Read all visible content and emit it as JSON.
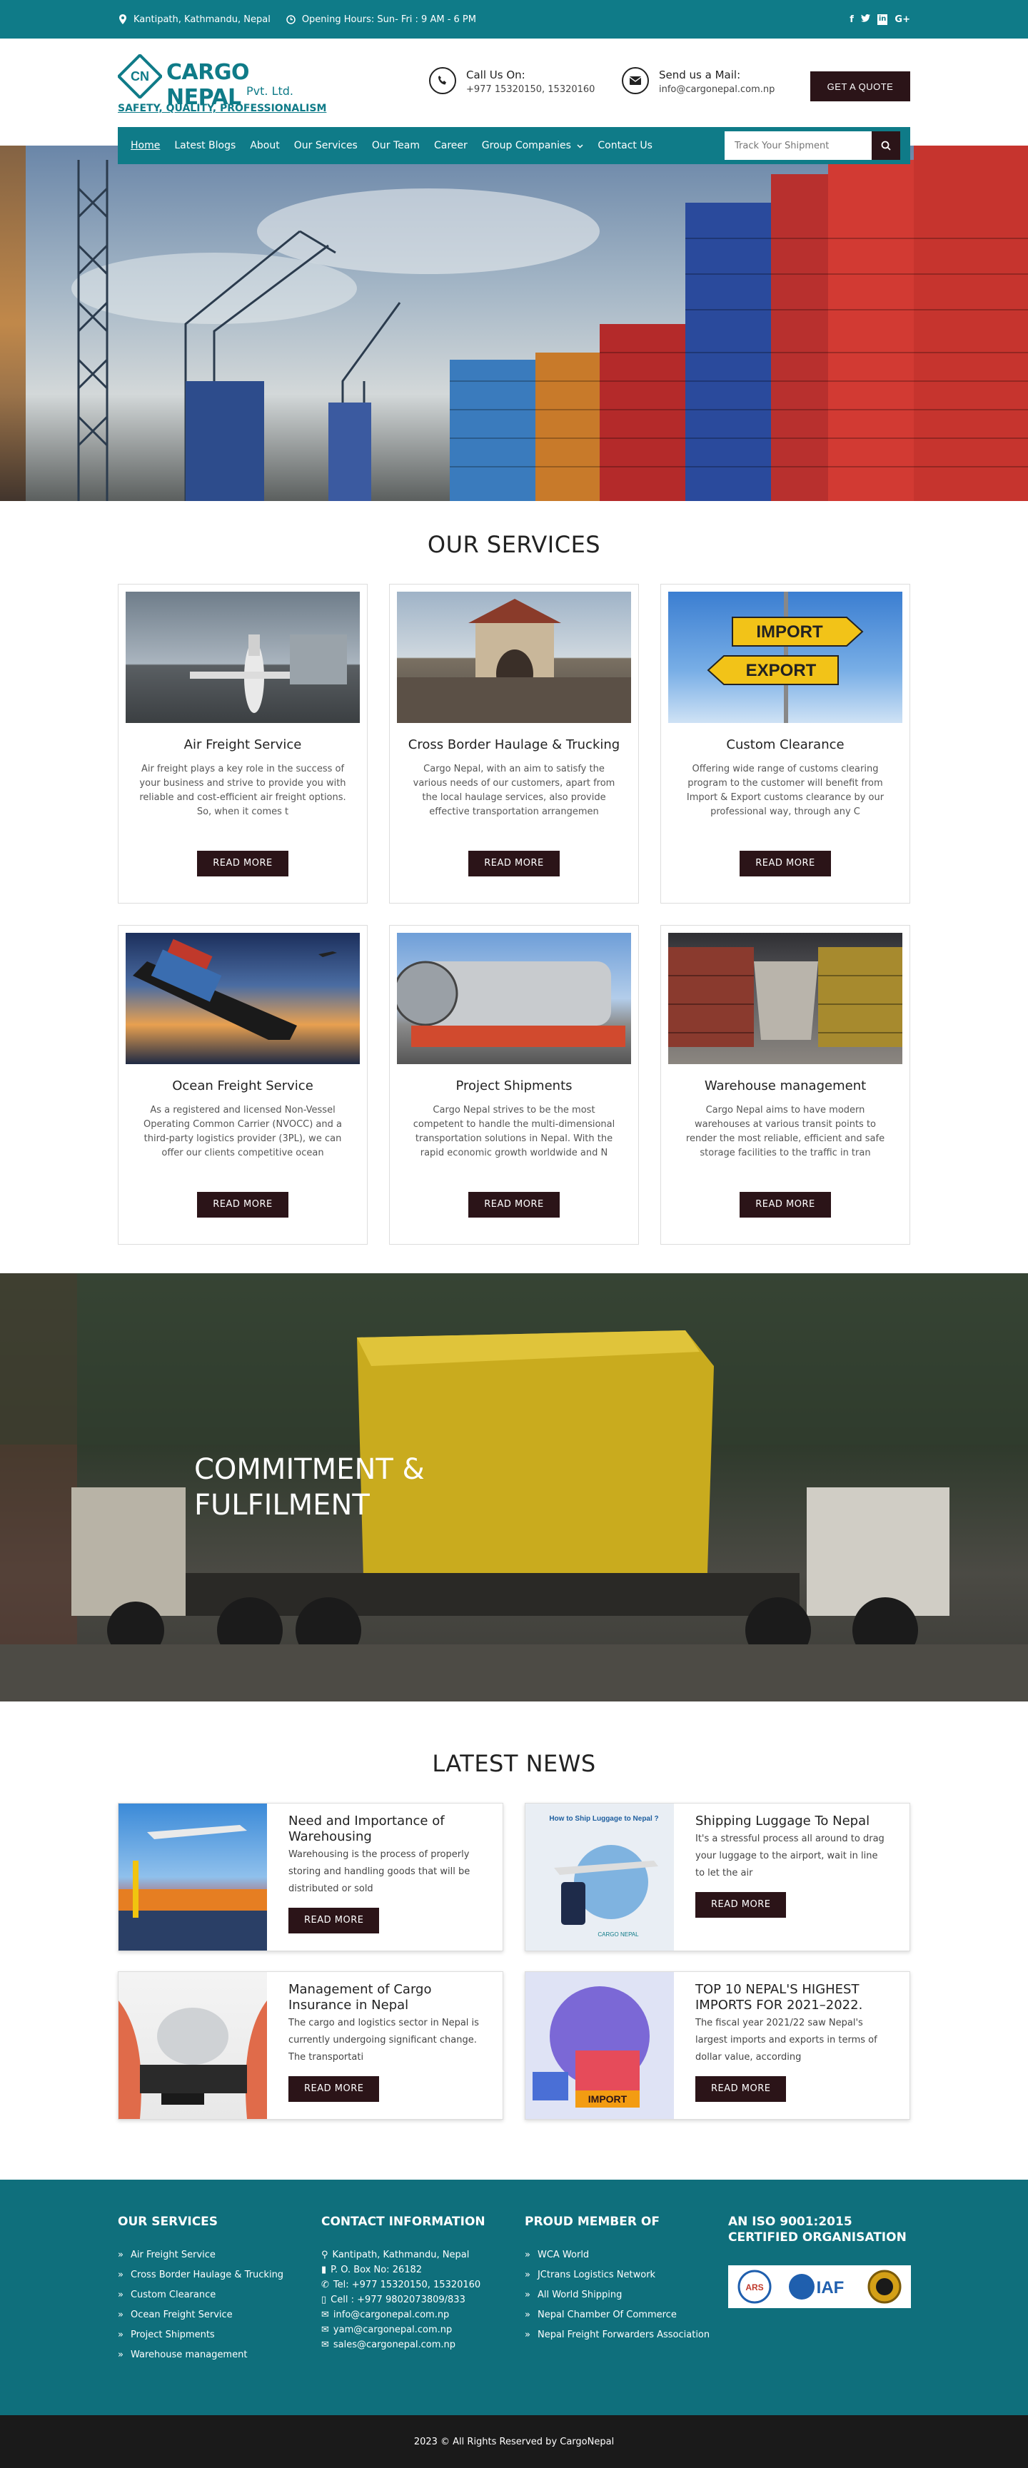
{
  "topbar": {
    "address": "Kantipath, Kathmandu, Nepal",
    "hours": "Opening Hours: Sun- Fri : 9 AM - 6 PM",
    "social": [
      "f",
      "t",
      "in",
      "G+"
    ]
  },
  "header": {
    "logo_initials": "CN",
    "logo_name": "CARGO NEPAL",
    "logo_sub": "Pvt. Ltd.",
    "logo_tagline": "SAFETY, QUALITY, PROFESSIONALISM",
    "call_label": "Call Us On:",
    "call_value": "+977 15320150, 15320160",
    "mail_label": "Send us a Mail:",
    "mail_value": "info@cargonepal.com.np",
    "quote_button": "GET A QUOTE"
  },
  "nav": {
    "items": [
      "Home",
      "Latest Blogs",
      "About",
      "Our Services",
      "Our Team",
      "Career",
      "Group Companies",
      "Contact Us"
    ],
    "track_placeholder": "Track Your Shipment"
  },
  "services": {
    "title": "OUR SERVICES",
    "read_more": "READ MORE",
    "cards": [
      {
        "title": "Air Freight Service",
        "text": "Air freight plays a key role in the success of your business and strive to provide you with reliable and cost-efficient air freight options. So, when it comes t"
      },
      {
        "title": "Cross Border Haulage & Trucking",
        "text": "Cargo Nepal, with an aim to satisfy the various needs of our customers, apart from the local haulage services, also provide effective transportation arrangemen"
      },
      {
        "title": "Custom Clearance",
        "text": "Offering wide range of customs clearing program to the customer will benefit from Import & Export customs clearance by our professional way, through any C",
        "sign_top": "IMPORT",
        "sign_bottom": "EXPORT"
      },
      {
        "title": "Ocean Freight Service",
        "text": "As a registered and licensed Non-Vessel Operating Common Carrier (NVOCC) and a third-party logistics provider (3PL), we can offer our clients competitive ocean"
      },
      {
        "title": "Project Shipments",
        "text": "Cargo Nepal strives to be the most competent to handle the multi-dimensional transportation solutions in Nepal. With the rapid economic growth worldwide and N"
      },
      {
        "title": "Warehouse management",
        "text": "Cargo Nepal aims to have modern warehouses at various transit points to render the most reliable, efficient and safe storage facilities to the traffic in tran"
      }
    ]
  },
  "banner": {
    "line1": "COMMITMENT &",
    "line2": "FULFILMENT"
  },
  "news": {
    "title": "LATEST NEWS",
    "read_more": "READ MORE",
    "items": [
      {
        "title": "Need and Importance of Warehousing",
        "text": "Warehousing is the process of properly storing and handling goods that will be distributed or sold"
      },
      {
        "title": "Shipping Luggage To Nepal",
        "text": "It's a stressful process all around to drag your luggage to the airport, wait in line to let the air",
        "img_caption": "How to Ship Luggage to Nepal ?",
        "img_logo": "CARGO NEPAL"
      },
      {
        "title": "Management of Cargo Insurance in Nepal",
        "text": "The cargo and logistics sector in Nepal is currently undergoing significant change. The transportati"
      },
      {
        "title": "TOP 10 NEPAL'S HIGHEST IMPORTS FOR 2021–2022.",
        "text": "The fiscal year 2021/22 saw Nepal's largest imports and exports in terms of dollar value, according",
        "img_caption": "IMPORT"
      }
    ]
  },
  "footer": {
    "services_title": "OUR SERVICES",
    "services": [
      "Air Freight Service",
      "Cross Border Haulage & Trucking",
      "Custom Clearance",
      "Ocean Freight Service",
      "Project Shipments",
      "Warehouse management"
    ],
    "contact_title": "CONTACT INFORMATION",
    "contact": [
      "Kantipath, Kathmandu, Nepal",
      "P. O. Box No: 26182",
      "Tel: +977 15320150, 15320160",
      "Cell : +977 9802073809/833",
      "info@cargonepal.com.np",
      "yam@cargonepal.com.np",
      "sales@cargonepal.com.np"
    ],
    "member_title": "PROUD MEMBER OF",
    "members": [
      "WCA World",
      "JCtrans Logistics Network",
      "All World Shipping",
      "Nepal Chamber Of Commerce",
      "Nepal Freight Forwarders Association"
    ],
    "iso_title": "AN ISO 9001:2015 CERTIFIED ORGANISATION",
    "cert_labels": [
      "ARS",
      "IAF"
    ],
    "copyright": "2023 © All Rights Reserved by CargoNepal"
  },
  "colors": {
    "teal": "#0f7b88",
    "dark": "#2b1418",
    "footer": "#0f6f7c",
    "copyright_bar": "#1a1a1a"
  }
}
